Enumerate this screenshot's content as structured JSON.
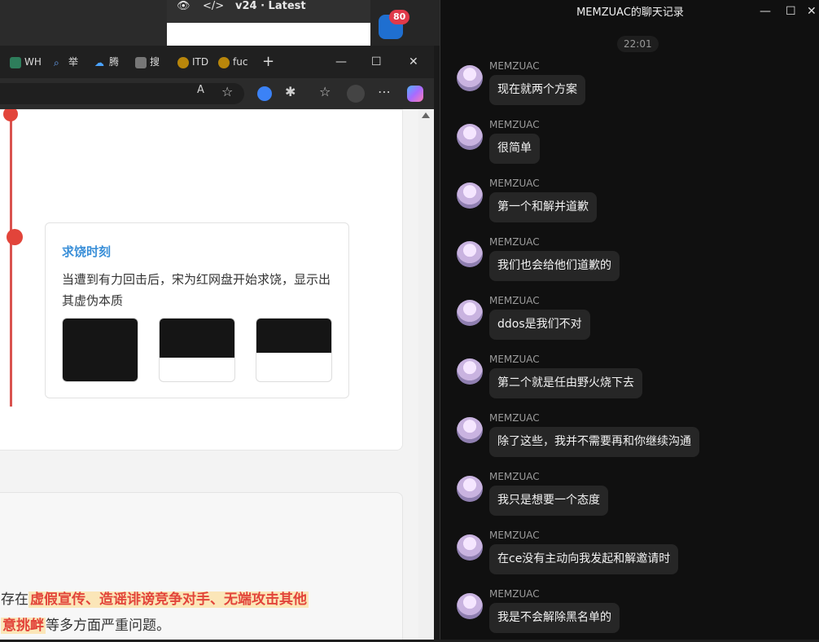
{
  "background": {
    "tab_title": "v24 · Latest",
    "badge_count": "80"
  },
  "browser": {
    "tabs": [
      {
        "label": "WH",
        "icon": "wrench-icon"
      },
      {
        "label": "举",
        "icon": "search-icon"
      },
      {
        "label": "腾",
        "icon": "cloud-icon"
      },
      {
        "label": "搜",
        "icon": "page-icon"
      },
      {
        "label": "ITD",
        "icon": "music-icon"
      },
      {
        "label": "fuc",
        "icon": "music-icon"
      }
    ],
    "new_tab": "+"
  },
  "page": {
    "event": {
      "title": "求饶时刻",
      "description": "当遭到有力回击后，宋为红网盘开始求饶，显示出其虚伪本质"
    },
    "line1_prefix": "存在",
    "line1_highlight": "虚假宣传、造谣诽谤竞争对手、无端攻击其他",
    "line2_highlight": "意挑衅",
    "line2_suffix": "等多方面严重问题。"
  },
  "chat": {
    "title": "MEMZUAC的聊天记录",
    "time": "22:01",
    "sender": "MEMZUAC",
    "messages": [
      "现在就两个方案",
      "很简单",
      "第一个和解并道歉",
      "我们也会给他们道歉的",
      "ddos是我们不对",
      "第二个就是任由野火烧下去",
      "除了这些，我并不需要再和你继续沟通",
      "我只是想要一个态度",
      "在ce没有主动向我发起和解邀请时",
      "我是不会解除黑名单的"
    ]
  }
}
